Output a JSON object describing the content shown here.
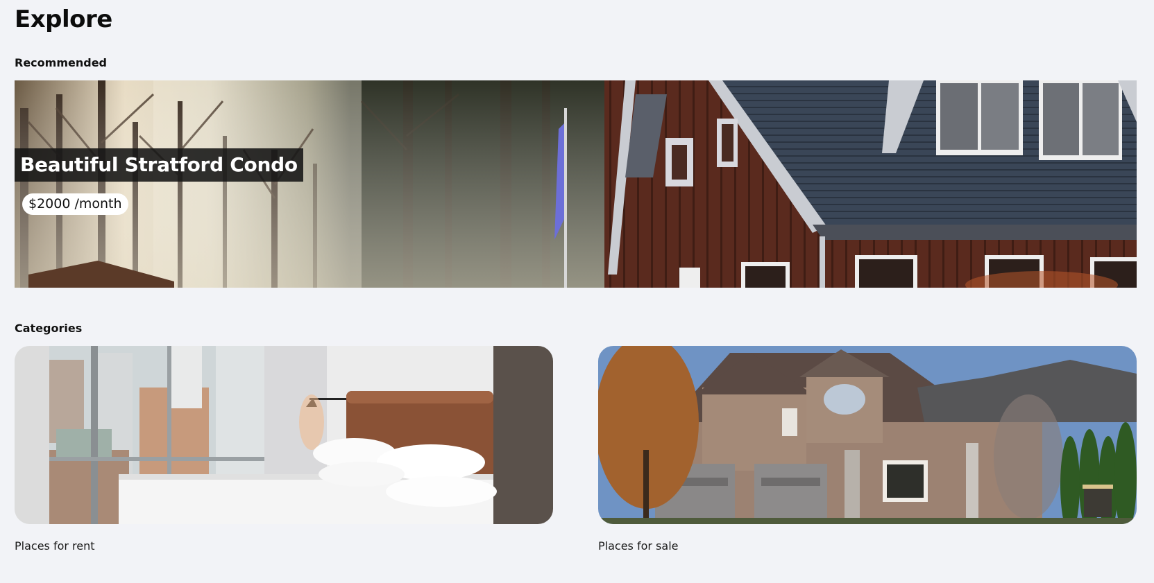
{
  "page": {
    "title": "Explore"
  },
  "recommended": {
    "heading": "Recommended",
    "listing": {
      "title": "Beautiful Stratford Condo",
      "price": "$2000 /month"
    }
  },
  "categories": {
    "heading": "Categories",
    "items": [
      {
        "label": "Places for rent",
        "image": "bedroom-photo"
      },
      {
        "label": "Places for sale",
        "image": "house-photo"
      }
    ]
  },
  "colors": {
    "background": "#f2f3f7",
    "title_overlay": "#141414",
    "price_pill": "#ffffff"
  }
}
